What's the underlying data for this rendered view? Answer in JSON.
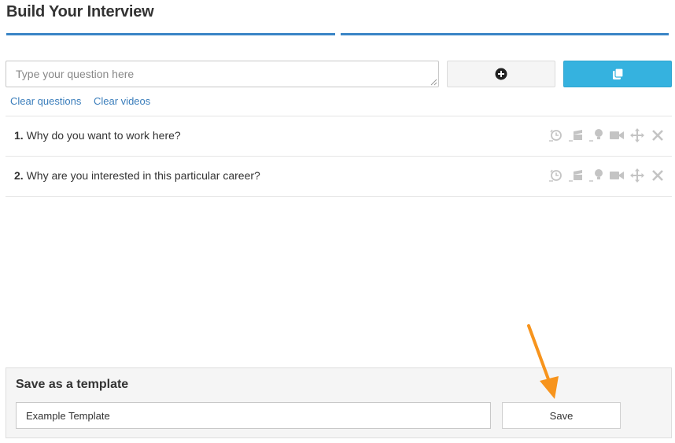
{
  "page": {
    "title": "Build Your Interview"
  },
  "question_input": {
    "placeholder": "Type your question here",
    "value": ""
  },
  "buttons": {
    "add_icon": "plus-circle-icon",
    "template_icon": "copy-icon"
  },
  "links": {
    "clear_questions": "Clear questions",
    "clear_videos": "Clear videos"
  },
  "questions": [
    {
      "number": "1.",
      "text": "Why do you want to work here?"
    },
    {
      "number": "2.",
      "text": "Why are you interested in this particular career?"
    }
  ],
  "question_actions": [
    "timer-icon",
    "clapperboard-icon",
    "lightbulb-icon",
    "video-camera-icon",
    "move-icon",
    "close-icon"
  ],
  "template": {
    "heading": "Save as a template",
    "input_value": "Example Template",
    "save_label": "Save"
  },
  "annotation": {
    "arrow_color": "#f7941d"
  },
  "colors": {
    "accent": "#35b2df",
    "step_bar": "#3a85c6",
    "link": "#3a7dbb"
  }
}
